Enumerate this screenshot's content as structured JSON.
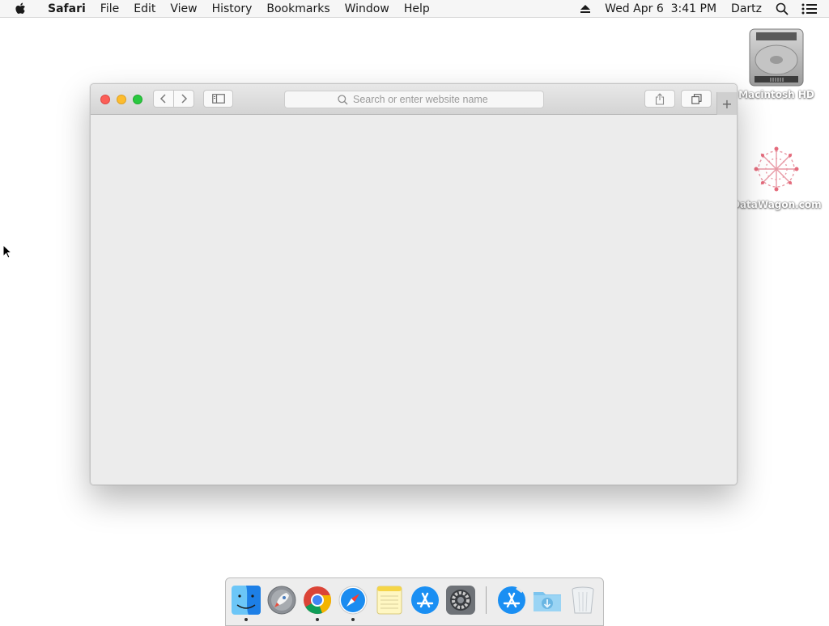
{
  "menubar": {
    "app_name": "Safari",
    "items": [
      "File",
      "Edit",
      "View",
      "History",
      "Bookmarks",
      "Window",
      "Help"
    ],
    "datetime": "Wed Apr 6  3:41 PM",
    "user": "Dartz"
  },
  "desktop": {
    "icons": [
      {
        "label": "Macintosh HD",
        "icon": "hard-drive-icon"
      },
      {
        "label": "DataWagon.com",
        "icon": "datawagon-logo-icon"
      }
    ]
  },
  "safari": {
    "address_placeholder": "Search or enter website name",
    "new_tab_label": "+"
  },
  "dock": {
    "apps": [
      {
        "name": "Finder",
        "icon": "finder-icon",
        "running": true
      },
      {
        "name": "Launchpad",
        "icon": "launchpad-icon",
        "running": false
      },
      {
        "name": "Google Chrome",
        "icon": "chrome-icon",
        "running": true
      },
      {
        "name": "Safari",
        "icon": "safari-icon",
        "running": true
      },
      {
        "name": "Notes",
        "icon": "notes-icon",
        "running": false
      },
      {
        "name": "App Store",
        "icon": "app-store-icon",
        "running": false
      },
      {
        "name": "System Preferences",
        "icon": "system-preferences-icon",
        "running": false
      },
      {
        "name": "Applications",
        "icon": "applications-folder-icon",
        "running": false
      },
      {
        "name": "Downloads",
        "icon": "downloads-folder-icon",
        "running": false
      },
      {
        "name": "Trash",
        "icon": "trash-icon",
        "running": false
      }
    ]
  },
  "colors": {
    "close": "#fc5f57",
    "minimize": "#fdbc2e",
    "maximize": "#29c840",
    "safari_blue": "#1b8cf0"
  }
}
